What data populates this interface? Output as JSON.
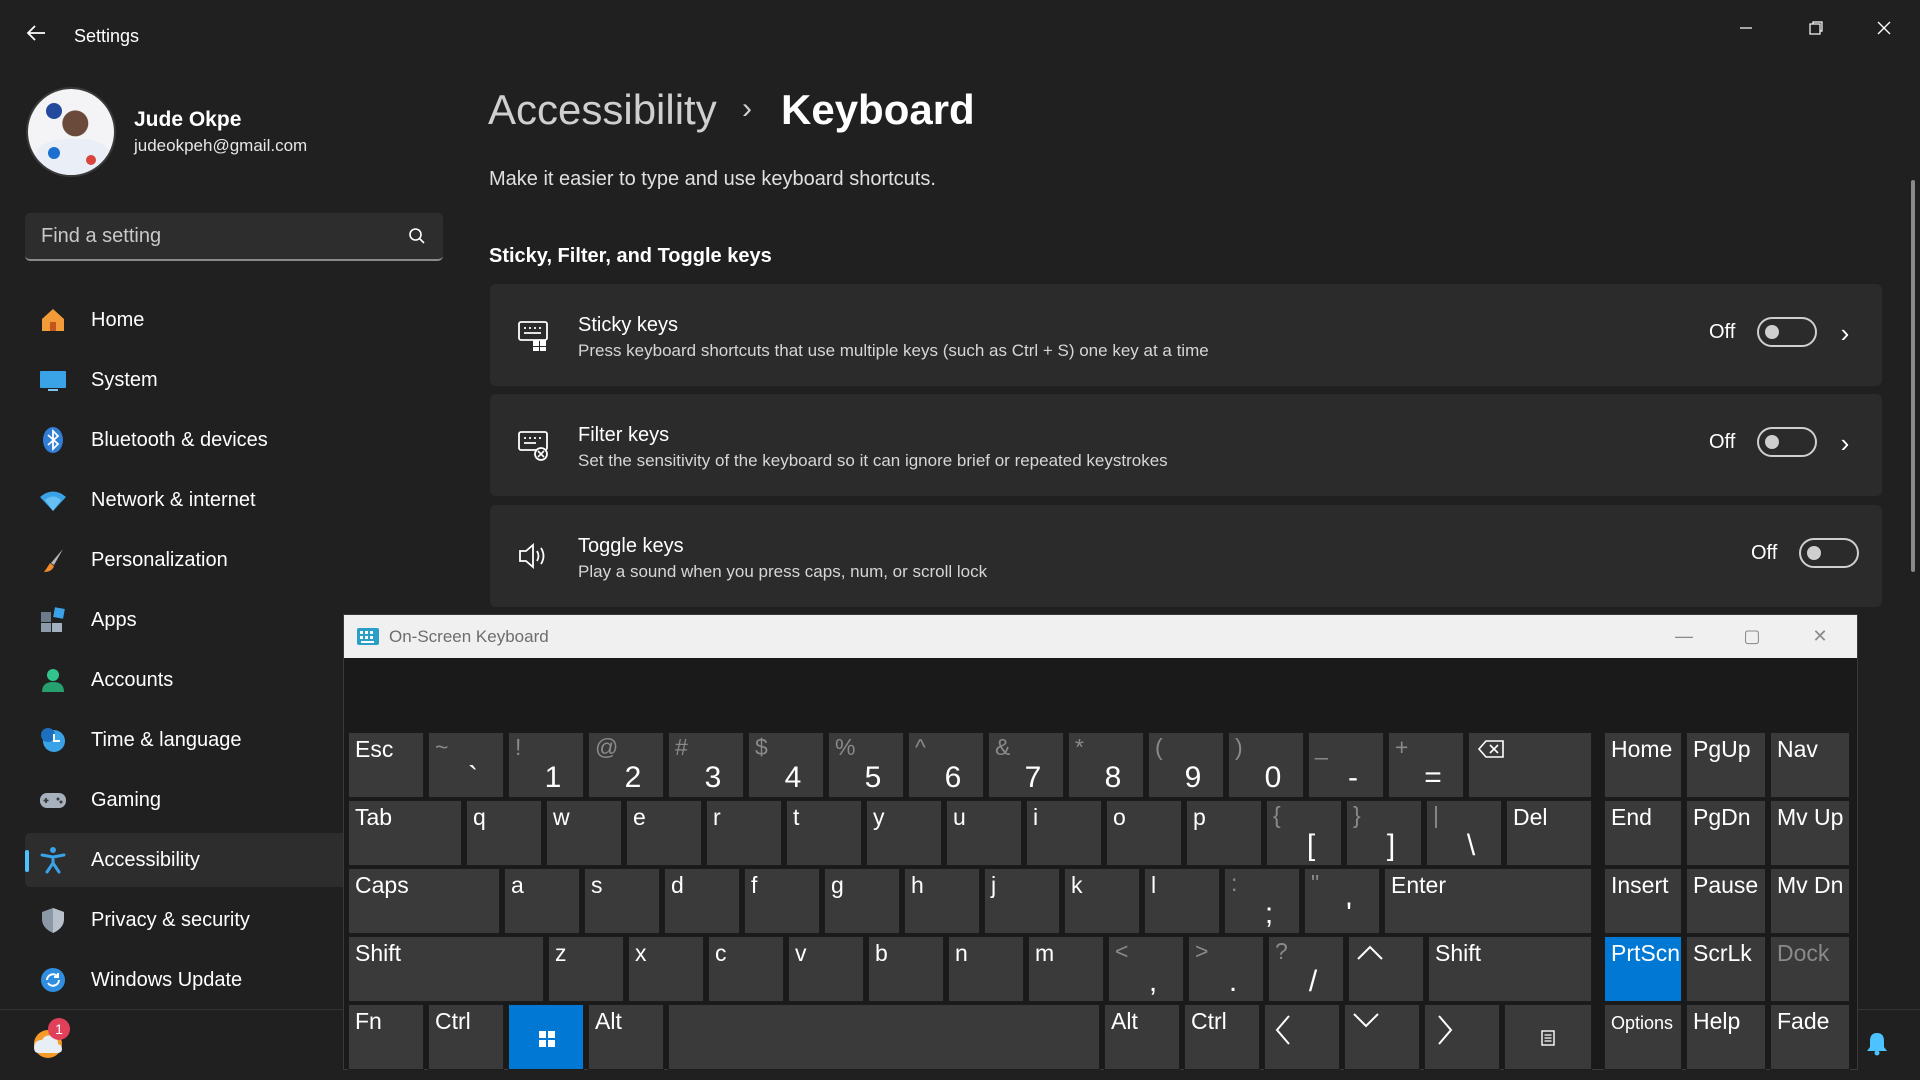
{
  "window": {
    "title": "Settings",
    "back_icon": "back-arrow-icon"
  },
  "profile": {
    "name": "Jude Okpe",
    "email": "judeokpeh@gmail.com"
  },
  "search": {
    "placeholder": "Find a setting"
  },
  "nav": {
    "items": [
      {
        "label": "Home",
        "icon": "home-icon"
      },
      {
        "label": "System",
        "icon": "system-icon"
      },
      {
        "label": "Bluetooth & devices",
        "icon": "bluetooth-icon"
      },
      {
        "label": "Network & internet",
        "icon": "wifi-icon"
      },
      {
        "label": "Personalization",
        "icon": "brush-icon"
      },
      {
        "label": "Apps",
        "icon": "apps-icon"
      },
      {
        "label": "Accounts",
        "icon": "accounts-icon"
      },
      {
        "label": "Time & language",
        "icon": "clock-icon"
      },
      {
        "label": "Gaming",
        "icon": "gamepad-icon"
      },
      {
        "label": "Accessibility",
        "icon": "accessibility-icon",
        "active": true
      },
      {
        "label": "Privacy & security",
        "icon": "shield-icon"
      },
      {
        "label": "Windows Update",
        "icon": "update-icon"
      }
    ]
  },
  "main": {
    "breadcrumb": {
      "parent": "Accessibility",
      "separator": "›",
      "current": "Keyboard"
    },
    "subtitle": "Make it easier to type and use keyboard shortcuts.",
    "section_heading": "Sticky, Filter, and Toggle keys",
    "cards": [
      {
        "title": "Sticky keys",
        "desc": "Press keyboard shortcuts that use multiple keys (such as Ctrl + S) one key at a time",
        "state": "Off",
        "icon": "sticky-keys-icon",
        "has_chevron": true
      },
      {
        "title": "Filter keys",
        "desc": "Set the sensitivity of the keyboard so it can ignore brief or repeated keystrokes",
        "state": "Off",
        "icon": "filter-keys-icon",
        "has_chevron": true
      },
      {
        "title": "Toggle keys",
        "desc": "Play a sound when you press caps, num, or scroll lock",
        "state": "Off",
        "icon": "speaker-icon",
        "has_chevron": false
      }
    ]
  },
  "taskbar": {
    "notification_count": "1"
  },
  "osk": {
    "title": "On-Screen Keyboard",
    "row1": [
      {
        "label": "Esc"
      },
      {
        "top": "~",
        "bottom": "`"
      },
      {
        "top": "!",
        "bottom": "1"
      },
      {
        "top": "@",
        "bottom": "2"
      },
      {
        "top": "#",
        "bottom": "3"
      },
      {
        "top": "$",
        "bottom": "4"
      },
      {
        "top": "%",
        "bottom": "5"
      },
      {
        "top": "^",
        "bottom": "6"
      },
      {
        "top": "&",
        "bottom": "7"
      },
      {
        "top": "*",
        "bottom": "8"
      },
      {
        "top": "(",
        "bottom": "9"
      },
      {
        "top": ")",
        "bottom": "0"
      },
      {
        "top": "_",
        "bottom": "-"
      },
      {
        "top": "+",
        "bottom": "="
      }
    ],
    "row2": [
      {
        "label": "Tab"
      },
      {
        "label": "q"
      },
      {
        "label": "w"
      },
      {
        "label": "e"
      },
      {
        "label": "r"
      },
      {
        "label": "t"
      },
      {
        "label": "y"
      },
      {
        "label": "u"
      },
      {
        "label": "i"
      },
      {
        "label": "o"
      },
      {
        "label": "p"
      },
      {
        "top": "{",
        "bottom": "["
      },
      {
        "top": "}",
        "bottom": "]"
      },
      {
        "top": "|",
        "bottom": "\\"
      },
      {
        "label": "Del"
      }
    ],
    "row3": [
      {
        "label": "Caps"
      },
      {
        "label": "a"
      },
      {
        "label": "s"
      },
      {
        "label": "d"
      },
      {
        "label": "f"
      },
      {
        "label": "g"
      },
      {
        "label": "h"
      },
      {
        "label": "j"
      },
      {
        "label": "k"
      },
      {
        "label": "l"
      },
      {
        "top": ":",
        "bottom": ";"
      },
      {
        "top": "\"",
        "bottom": "'"
      },
      {
        "label": "Enter"
      }
    ],
    "row4": [
      {
        "label": "Shift"
      },
      {
        "label": "z"
      },
      {
        "label": "x"
      },
      {
        "label": "c"
      },
      {
        "label": "v"
      },
      {
        "label": "b"
      },
      {
        "label": "n"
      },
      {
        "label": "m"
      },
      {
        "top": "<",
        "bottom": ","
      },
      {
        "top": ">",
        "bottom": "."
      },
      {
        "top": "?",
        "bottom": "/"
      },
      {
        "label": "Shift"
      }
    ],
    "row5": [
      {
        "label": "Fn"
      },
      {
        "label": "Ctrl"
      },
      {
        "label": "Alt"
      },
      {
        "label": "Alt"
      },
      {
        "label": "Ctrl"
      }
    ],
    "nav_keys": {
      "home": "Home",
      "pgup": "PgUp",
      "nav": "Nav",
      "end": "End",
      "pgdn": "PgDn",
      "mvup": "Mv Up",
      "insert": "Insert",
      "pause": "Pause",
      "mvdn": "Mv Dn",
      "prtscn": "PrtScn",
      "scrlk": "ScrLk",
      "dock": "Dock",
      "options": "Options",
      "help": "Help",
      "fade": "Fade"
    },
    "colors": {
      "key": "#3a3a3a",
      "active": "#0078d4"
    }
  },
  "colors": {
    "accent": "#4cc2ff",
    "background": "#202020",
    "card": "#2b2b2b"
  }
}
